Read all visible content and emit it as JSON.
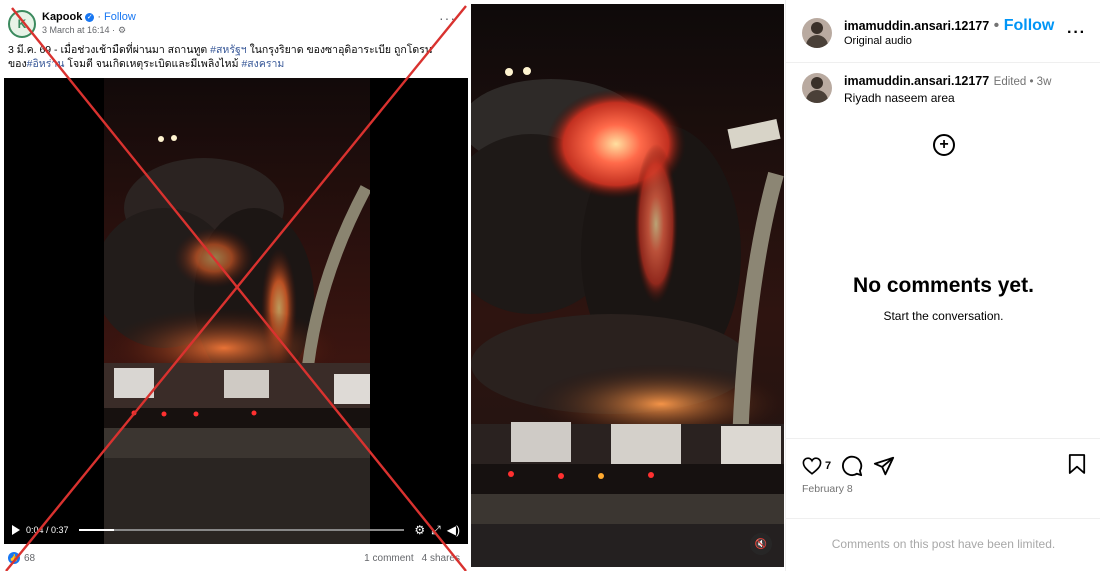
{
  "facebook_post": {
    "page_name": "Kapook",
    "separator": "·",
    "follow_label": "Follow",
    "timestamp": "3 March at 16:14 ·",
    "caption_text": "3 มี.ค. 69 - เมื่อช่วงเช้ามืดที่ผ่านมา สถานทูต ",
    "caption_tag_1": "#สหรัฐฯ",
    "caption_text_2": " ในกรุงริยาด ของซาอุดิอาระเบีย ถูกโดรนของ",
    "caption_tag_2": "#อิหร่าน",
    "caption_text_3": " โจมตี จนเกิดเหตุระเบิดและมีเพลิงไหม้ ",
    "caption_tag_3": "#สงคราม",
    "video_time": "0:04 / 0:37",
    "progress": 0.11,
    "reaction_count": "68",
    "comments_label": "1 comment",
    "shares_label": "4 shares"
  },
  "instagram": {
    "username": "imamuddin.ansari.12177",
    "separator": "•",
    "follow_label": "Follow",
    "audio_label": "Original audio",
    "caption_username": "imamuddin.ansari.12177",
    "caption_meta": "Edited • 3w",
    "caption_text": "Riyadh naseem area",
    "empty_title": "No comments yet.",
    "empty_subtitle": "Start the conversation.",
    "like_count": "7",
    "post_date": "February 8",
    "comments_limited": "Comments on this post have been limited."
  },
  "colors": {
    "facebook_blue": "#1877f2",
    "instagram_blue": "#0095f6",
    "red_cross": "#d9322f",
    "muted_gray": "#737373"
  },
  "icons": [
    "verified-badge-icon",
    "gear-icon",
    "play-icon",
    "settings-icon",
    "fullscreen-icon",
    "volume-icon",
    "like-icon",
    "mute-icon",
    "add-comment-icon",
    "heart-icon",
    "comment-icon",
    "share-icon",
    "bookmark-icon",
    "more-icon"
  ]
}
